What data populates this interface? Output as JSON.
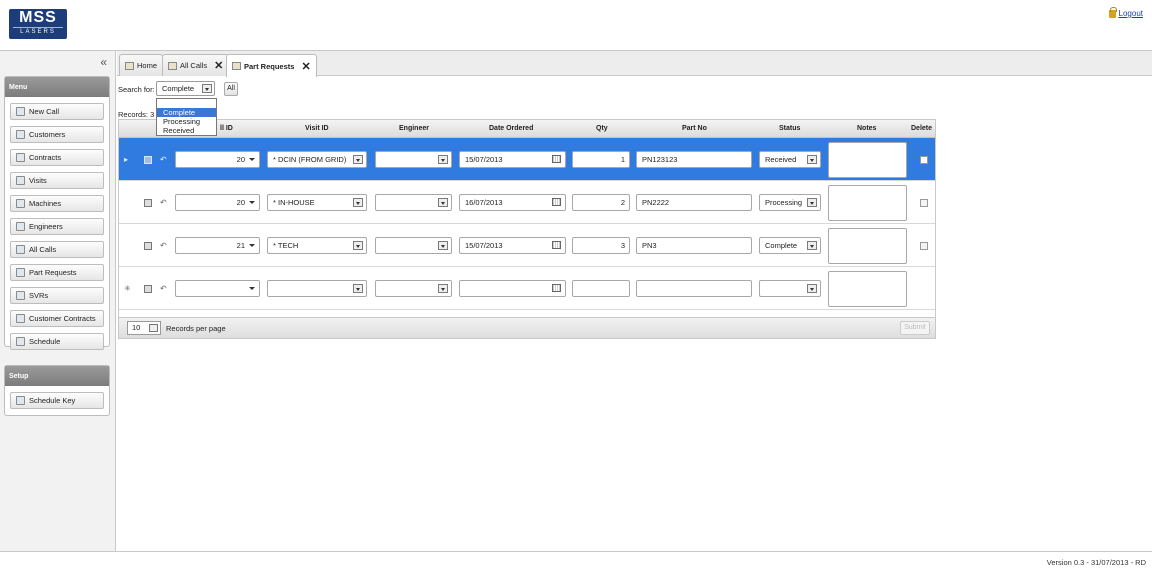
{
  "header": {
    "logo_top": "MSS",
    "logo_bottom": "LASERS",
    "logout_label": "Logout"
  },
  "sidebar": {
    "menu_title": "Menu",
    "items": [
      {
        "label": "New Call",
        "icon": "new-call-icon"
      },
      {
        "label": "Customers",
        "icon": "customers-icon"
      },
      {
        "label": "Contracts",
        "icon": "contracts-icon"
      },
      {
        "label": "Visits",
        "icon": "visits-icon"
      },
      {
        "label": "Machines",
        "icon": "machines-icon"
      },
      {
        "label": "Engineers",
        "icon": "engineers-icon"
      },
      {
        "label": "All Calls",
        "icon": "all-calls-icon"
      },
      {
        "label": "Part Requests",
        "icon": "part-requests-icon"
      },
      {
        "label": "SVRs",
        "icon": "svrs-icon"
      },
      {
        "label": "Customer Contracts",
        "icon": "customer-contracts-icon"
      },
      {
        "label": "Schedule",
        "icon": "schedule-icon"
      }
    ],
    "setup_title": "Setup",
    "setup_items": [
      {
        "label": "Schedule Key",
        "icon": "schedule-key-icon"
      }
    ]
  },
  "tabs": [
    {
      "label": "Home"
    },
    {
      "label": "All Calls"
    },
    {
      "label": "Part Requests"
    }
  ],
  "search": {
    "label": "Search for:",
    "value": "Complete",
    "options": [
      "",
      "Complete",
      "Processing",
      "Received"
    ],
    "all_label": "All"
  },
  "records_label": "Records: 3",
  "grid": {
    "columns": [
      "ll ID",
      "Visit ID",
      "Engineer",
      "Date Ordered",
      "Qty",
      "Part No",
      "Status",
      "Notes",
      "Delete"
    ],
    "rows": [
      {
        "call_id": "20",
        "visit_id": "* DCIN (FROM GRID)",
        "engineer": "",
        "date": "15/07/2013",
        "qty": "1",
        "part_no": "PN123123",
        "status": "Received"
      },
      {
        "call_id": "20",
        "visit_id": "* IN-HOUSE",
        "engineer": "",
        "date": "16/07/2013",
        "qty": "2",
        "part_no": "PN2222",
        "status": "Processing"
      },
      {
        "call_id": "21",
        "visit_id": "* TECH",
        "engineer": "",
        "date": "15/07/2013",
        "qty": "3",
        "part_no": "PN3",
        "status": "Complete"
      },
      {
        "call_id": "",
        "visit_id": "",
        "engineer": "",
        "date": "",
        "qty": "",
        "part_no": "",
        "status": ""
      }
    ]
  },
  "pager": {
    "page_size": "10",
    "label": "Records per page",
    "submit_label": "Submit"
  },
  "footer": {
    "version": "Version 0.3 - 31/07/2013 - RD"
  }
}
